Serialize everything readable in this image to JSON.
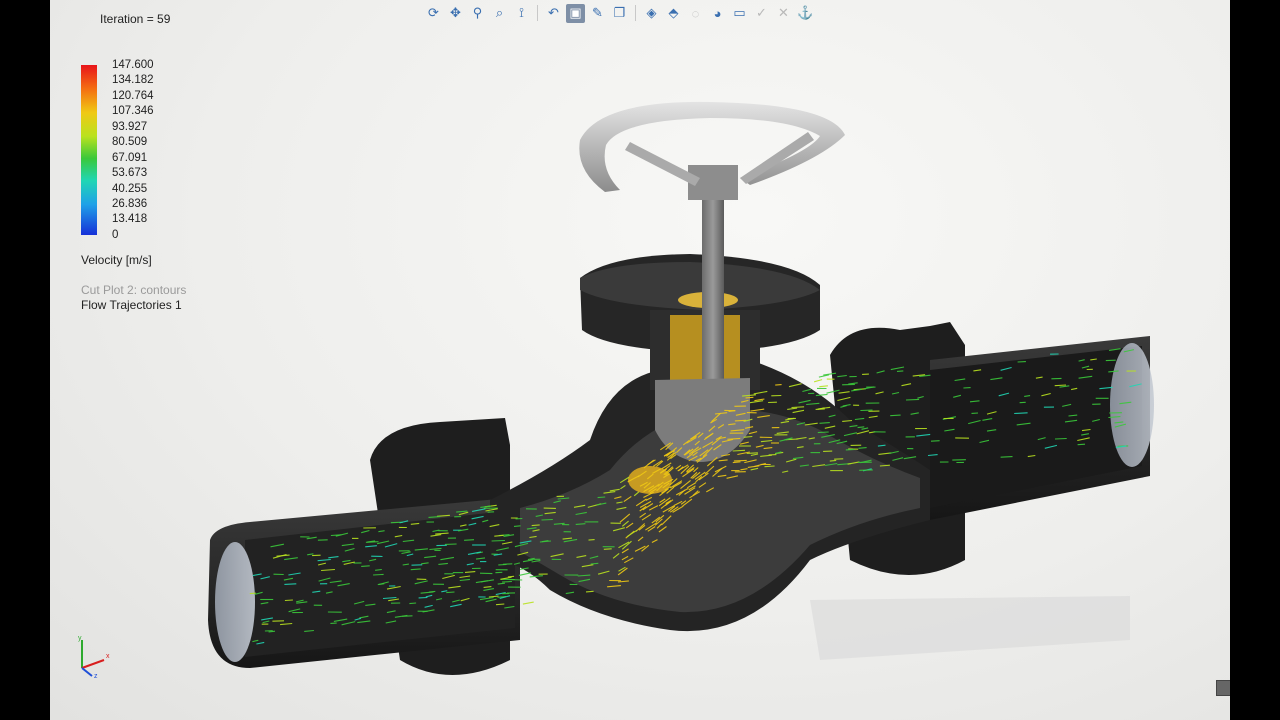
{
  "status": {
    "iteration": "Iteration = 59"
  },
  "toolbar": {
    "icons": [
      "rotate-icon",
      "pan-icon",
      "zoom-icon",
      "zoom-area-icon",
      "section-view-icon",
      "previous-view-icon",
      "display-style-icon",
      "view-orientation-icon",
      "hide-show-icon",
      "edit-appearance-icon",
      "apply-scene-icon",
      "view-settings-icon",
      "render-icon",
      "display-manager-icon",
      "anchor-icon"
    ]
  },
  "legend": {
    "ticks": [
      "147.600",
      "134.182",
      "120.764",
      "107.346",
      "93.927",
      "80.509",
      "67.091",
      "53.673",
      "40.255",
      "26.836",
      "13.418",
      "0"
    ],
    "unit": "Velocity [m/s]",
    "colors": [
      "#e8141a",
      "#f46e12",
      "#f0c914",
      "#b9e21f",
      "#3ac83a",
      "#20d6b4",
      "#1fa1e8",
      "#1630d8"
    ]
  },
  "plots": {
    "cut_plot": "Cut Plot 2: contours",
    "trajectories": "Flow Trajectories 1"
  },
  "axes": {
    "x": "x",
    "y": "y",
    "z": "z"
  }
}
